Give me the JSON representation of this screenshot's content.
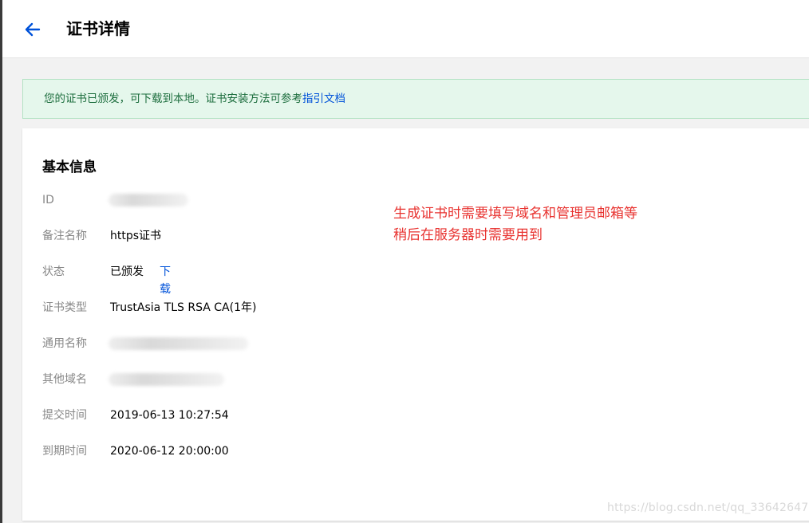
{
  "header": {
    "title": "证书详情",
    "back_icon": "arrow-left-icon",
    "accent": "#0052d9"
  },
  "notice": {
    "text": "您的证书已颁发，可下载到本地。证书安装方法可参考",
    "link": "指引文档"
  },
  "card": {
    "section_title": "基本信息",
    "rows": [
      {
        "label": "ID",
        "value": ""
      },
      {
        "label": "备注名称",
        "value": "https证书"
      },
      {
        "label": "状态",
        "value": "已颁发",
        "link": "下载"
      },
      {
        "label": "证书类型",
        "value": "TrustAsia TLS RSA CA(1年)"
      },
      {
        "label": "通用名称",
        "value": ""
      },
      {
        "label": "其他域名",
        "value": ""
      },
      {
        "label": "提交时间",
        "value": "2019-06-13 10:27:54"
      },
      {
        "label": "到期时间",
        "value": "2020-06-12 20:00:00"
      }
    ]
  },
  "annotation": {
    "line1": "生成证书时需要填写域名和管理员邮箱等",
    "line2": "稍后在服务器时需要用到",
    "color": "#e8322f"
  },
  "watermark": "https://blog.csdn.net/qq_33642647"
}
